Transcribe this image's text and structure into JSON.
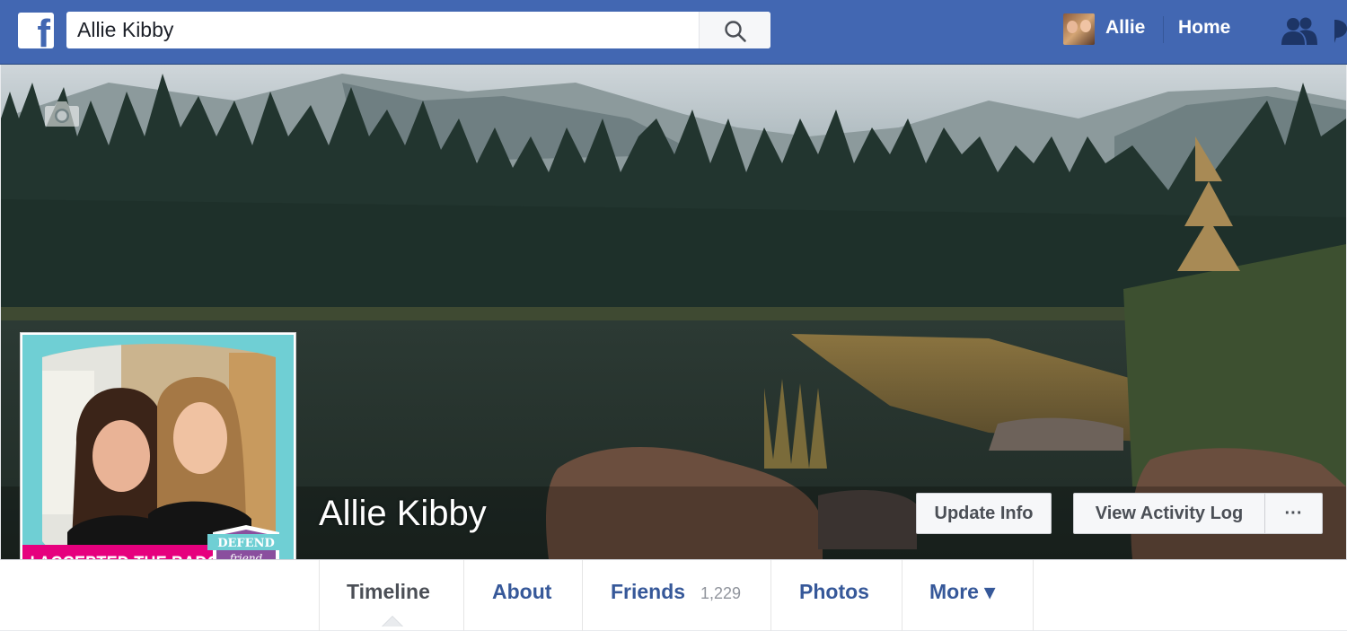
{
  "topbar": {
    "search_value": "Allie Kibby",
    "user_name": "Allie",
    "home_label": "Home"
  },
  "profile": {
    "name": "Allie Kibby",
    "badge_text": "I ACCEPTED THE BADGE",
    "badge_logo_top": "DEFEND",
    "badge_logo_bottom": "friend"
  },
  "cover_actions": {
    "update_info": "Update Info",
    "view_activity_log": "View Activity Log",
    "more": "···"
  },
  "tabs": [
    {
      "label": "Timeline",
      "active": true
    },
    {
      "label": "About"
    },
    {
      "label": "Friends",
      "count": "1,229"
    },
    {
      "label": "Photos"
    },
    {
      "label": "More ▾"
    }
  ],
  "colors": {
    "brand": "#4267b2",
    "link": "#365899",
    "badge_pink": "#e6007e",
    "badge_teal": "#6fcfd4"
  }
}
